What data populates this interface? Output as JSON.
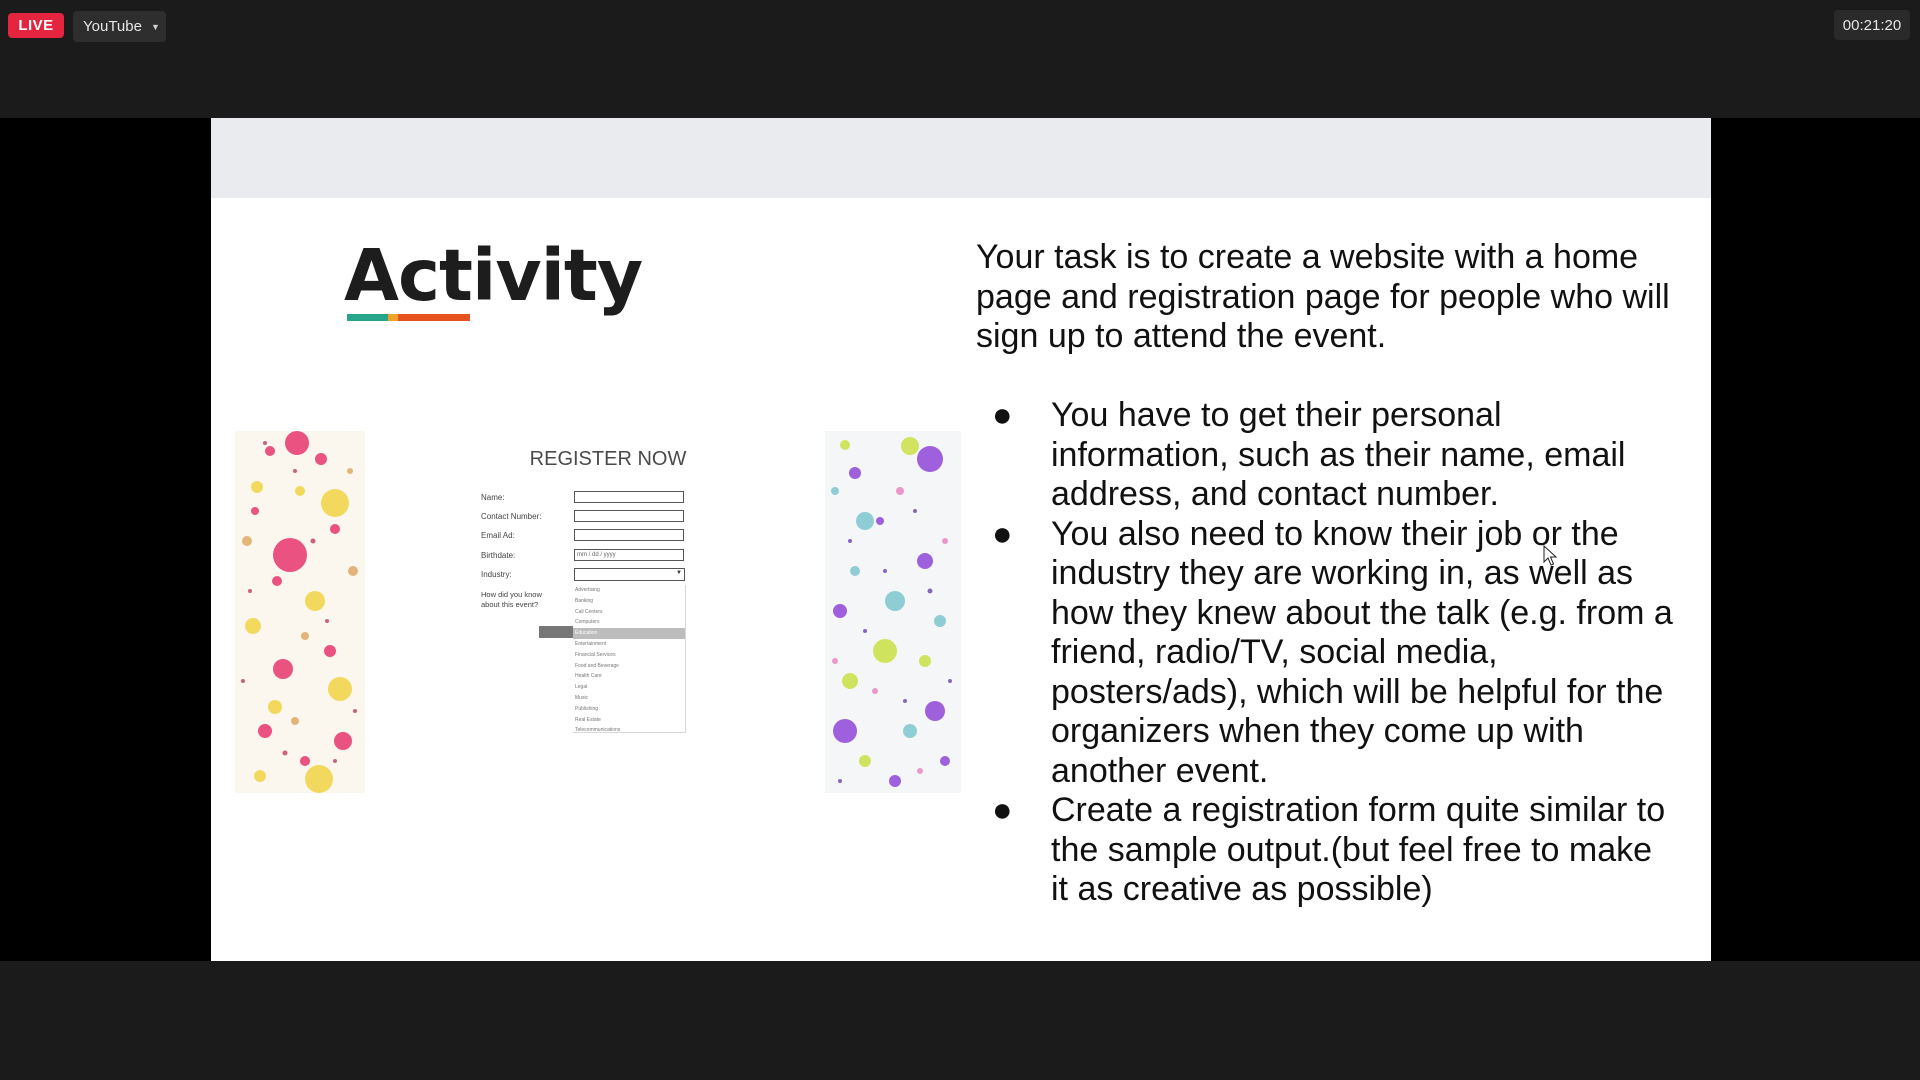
{
  "stream": {
    "live_label": "LIVE",
    "platform": "YouTube",
    "elapsed": "00:21:20"
  },
  "slide": {
    "title": "Activity",
    "underline_colors": [
      "#27a58a",
      "#f2a12a",
      "#e8521f"
    ],
    "register_form": {
      "heading": "REGISTER NOW",
      "fields": [
        {
          "label": "Name:",
          "value": ""
        },
        {
          "label": "Contact Number:",
          "value": ""
        },
        {
          "label": "Email Ad:",
          "value": ""
        },
        {
          "label": "Birthdate:",
          "value": "mm / dd / yyyy"
        },
        {
          "label": "Industry:",
          "value": ""
        }
      ],
      "how_label": "How did you know about this event?",
      "industry_options": [
        "Advertising",
        "Banking",
        "Call Centers",
        "Computers",
        "Education",
        "Entertainment",
        "Financial Services",
        "Food and Beverage",
        "Health Care",
        "Legal",
        "Music",
        "Publishing",
        "Real Estate",
        "Telecommunications"
      ],
      "selected_option": "Education"
    },
    "task_intro": "Your task is to create a website with a home page and registration page for people who will sign up to attend the event.",
    "bullets": [
      "You have to get their personal information, such as their name, email address, and contact number.",
      "You also need to know their job or the industry they are working in, as well as how they knew about the talk (e.g. from a friend, radio/TV, social media, posters/ads), which will be helpful for the organizers when they come up with another event.",
      "Create a registration form quite similar to the sample output.(but feel free to make it as creative as possible)"
    ],
    "bullet_glyph": "●"
  }
}
